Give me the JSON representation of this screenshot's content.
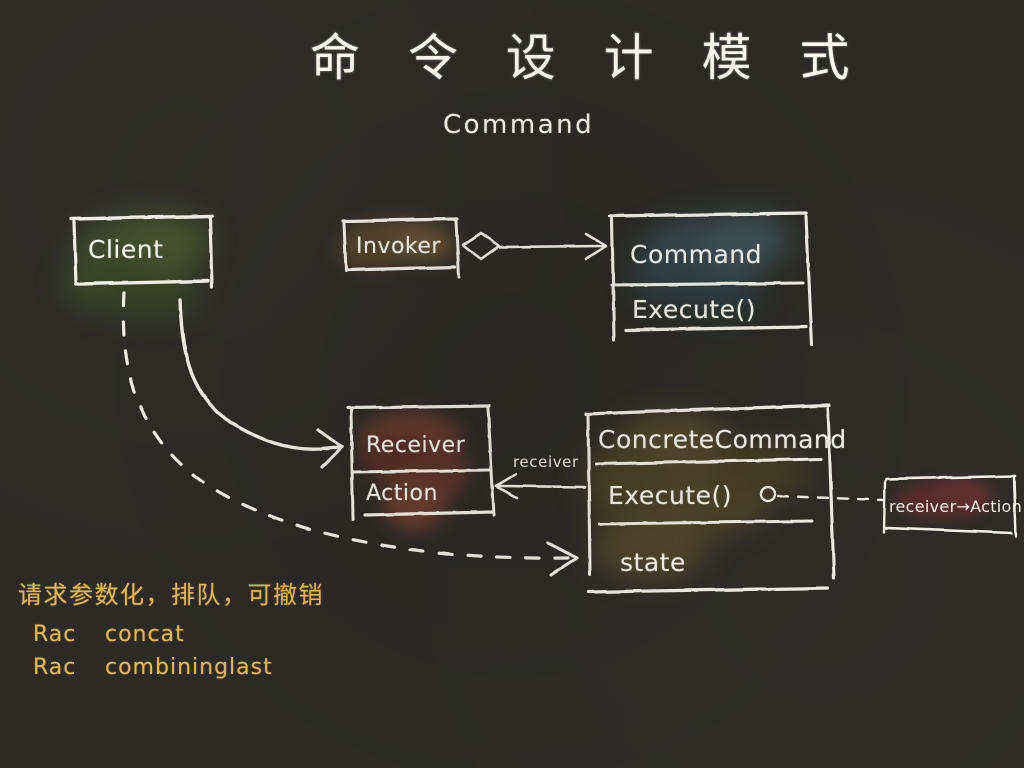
{
  "canvas": {
    "background_color": "#2b2a25",
    "stroke_color": "#f2efe6",
    "accent_color": "#e8b84b"
  },
  "title": {
    "main": "命 令 设 计 模 式",
    "subtitle": "Command"
  },
  "boxes": [
    {
      "id": "client",
      "name": "Client",
      "title": "Client",
      "compartments": [],
      "wash_color": "#4a5a30"
    },
    {
      "id": "invoker",
      "name": "Invoker",
      "title": "Invoker",
      "compartments": [],
      "wash_color": "#7a5c38"
    },
    {
      "id": "command",
      "name": "Command",
      "title": "Command",
      "compartments": [
        "Execute()"
      ],
      "wash_color": "#3f5c66"
    },
    {
      "id": "receiver",
      "name": "Receiver",
      "title": "Receiver",
      "compartments": [
        "Action"
      ],
      "wash_color": "#8a4436"
    },
    {
      "id": "concrete-command",
      "name": "ConcreteCommand",
      "title": "ConcreteCommand",
      "compartments": [
        "Execute()",
        "state"
      ],
      "wash_color": "#6e5c30"
    }
  ],
  "note": {
    "text": "receiver→Action",
    "wash_color": "#6e2a2a"
  },
  "edges": [
    {
      "id": "invoker-command",
      "label": "",
      "kind": "aggregation"
    },
    {
      "id": "concrete-receiver",
      "label": "receiver",
      "kind": "association"
    },
    {
      "id": "client-receiver",
      "label": "",
      "kind": "solid-curve"
    },
    {
      "id": "client-concrete",
      "label": "",
      "kind": "dashed-curve"
    },
    {
      "id": "execute-note",
      "label": "",
      "kind": "dashed-note-link"
    }
  ],
  "annotations": {
    "chinese": "请求参数化，排队，可撤销",
    "lines": [
      {
        "key": "Rac",
        "value": "concat"
      },
      {
        "key": "Rac",
        "value": "combininglast"
      }
    ]
  }
}
